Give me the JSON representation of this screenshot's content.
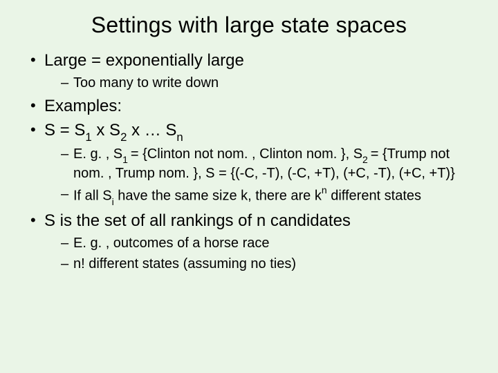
{
  "slide": {
    "title": "Settings with large state spaces",
    "bullets": [
      {
        "text": "Large = exponentially large",
        "sub": [
          {
            "text": "Too many to write down"
          }
        ]
      },
      {
        "text": "Examples:",
        "sub": []
      },
      {
        "prefix": "S = S",
        "sub1": "1",
        "mid1": " x S",
        "sub2": "2",
        "mid2": " x … S",
        "sub3": "n",
        "sub": [
          {
            "p0": "E. g. , S",
            "s1": "1 ",
            "p1": "= {Clinton not nom. , Clinton nom. }, S",
            "s2": "2 ",
            "p2": "= {Trump not nom. , Trump nom. }, S = {(-C, -T), (-C, +T), (+C, -T), (+C, +T)}"
          },
          {
            "p0": "If all S",
            "s1": "i",
            "p1": " have the same size k, there are k",
            "sup1": "n",
            "p2": " different states"
          }
        ]
      },
      {
        "text": "S is the set of all rankings of n candidates",
        "sub": [
          {
            "text": "E. g. , outcomes of a horse race"
          },
          {
            "text": "n! different states (assuming no ties)"
          }
        ]
      }
    ]
  }
}
